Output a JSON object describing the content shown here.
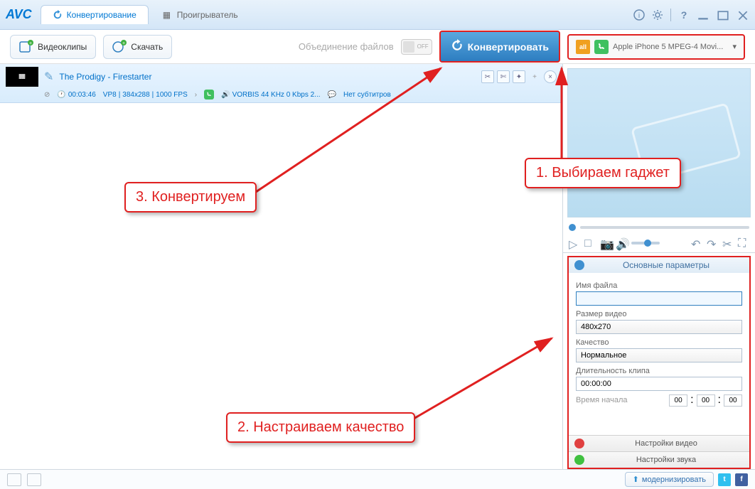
{
  "app": {
    "logo": "AVC"
  },
  "tabs": {
    "convert": "Конвертирование",
    "player": "Проигрыватель"
  },
  "toolbar": {
    "videoclips": "Видеоклипы",
    "download": "Скачать",
    "merge": "Объединение файлов",
    "toggle_off": "OFF",
    "convert": "Конвертировать",
    "all_badge": "all",
    "profile": "Apple iPhone 5 MPEG-4 Movi..."
  },
  "file": {
    "title": "The Prodigy - Firestarter",
    "duration": "00:03:46",
    "codec": "VP8",
    "resolution": "384x288",
    "fps": "1000 FPS",
    "audio": "VORBIS 44 KHz 0 Kbps 2...",
    "subs": "Нет субтитров"
  },
  "params": {
    "head": "Основные параметры",
    "filename_label": "Имя файла",
    "filename": "",
    "size_label": "Размер видео",
    "size": "480x270",
    "quality_label": "Качество",
    "quality": "Нормальное",
    "duration_label": "Длительность клипа",
    "duration": "00:00:00",
    "start_label": "Время начала",
    "t_hh": "00",
    "t_mm": "00",
    "t_ss": "00",
    "video_settings": "Настройки видео",
    "audio_settings": "Настройки звука"
  },
  "bottom": {
    "upgrade": "модернизировать"
  },
  "callouts": {
    "c1": "1. Выбираем гаджет",
    "c2": "2. Настраиваем качество",
    "c3": "3. Конвертируем"
  }
}
